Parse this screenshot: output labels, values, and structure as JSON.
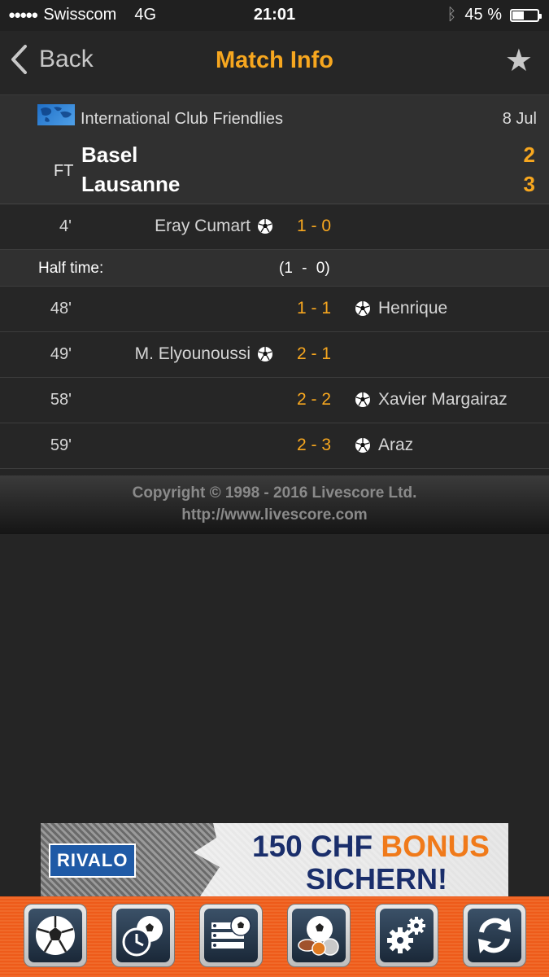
{
  "status_bar": {
    "carrier": "Swisscom",
    "network": "4G",
    "time": "21:01",
    "battery": "45 %",
    "battery_level": 0.45
  },
  "nav": {
    "back_label": "Back",
    "title": "Match Info"
  },
  "match": {
    "competition": "International Club Friendlies",
    "date": "8 Jul",
    "status": "FT",
    "home_team": "Basel",
    "away_team": "Lausanne",
    "home_score": "2",
    "away_score": "3"
  },
  "events": [
    {
      "minute": "4'",
      "home_player": "Eray Cumart",
      "score": "1 - 0",
      "away_player": ""
    },
    {
      "minute": "48'",
      "home_player": "",
      "score": "1 - 1",
      "away_player": "Henrique"
    },
    {
      "minute": "49'",
      "home_player": "M. Elyounoussi",
      "score": "2 - 1",
      "away_player": ""
    },
    {
      "minute": "58'",
      "home_player": "",
      "score": "2 - 2",
      "away_player": "Xavier Margairaz"
    },
    {
      "minute": "59'",
      "home_player": "",
      "score": "2 - 3",
      "away_player": "Araz"
    }
  ],
  "halftime": {
    "label": "Half time:",
    "score": "(1 - 0)"
  },
  "footer": {
    "copyright": "Copyright © 1998 - 2016 Livescore Ltd.",
    "url": "http://www.livescore.com"
  },
  "ad": {
    "brand": "RIVALO",
    "line1_a": "150 CHF",
    "line1_b": "BONUS",
    "line2": "SICHERN!"
  },
  "tabs": [
    "soccer-icon",
    "soccer-clock-icon",
    "soccer-list-icon",
    "multi-sports-icon",
    "settings-gears-icon",
    "refresh-icon"
  ],
  "colors": {
    "accent": "#f7a71f",
    "tabbar": "#ee5b1a",
    "background": "#252525"
  }
}
